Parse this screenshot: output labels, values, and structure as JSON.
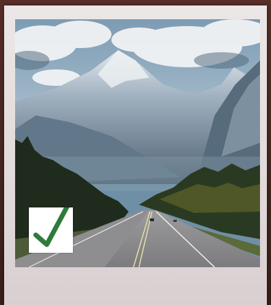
{
  "image": {
    "subject": "mountain-highway-polaroid",
    "icon": "checkmark-icon",
    "colors": {
      "frame": "#e6e0e1",
      "sky": "#6f8fa6",
      "mountain": "#5d7184",
      "forest": "#23301f",
      "road": "#8d8c8e",
      "check": "#2f7a3c"
    }
  }
}
